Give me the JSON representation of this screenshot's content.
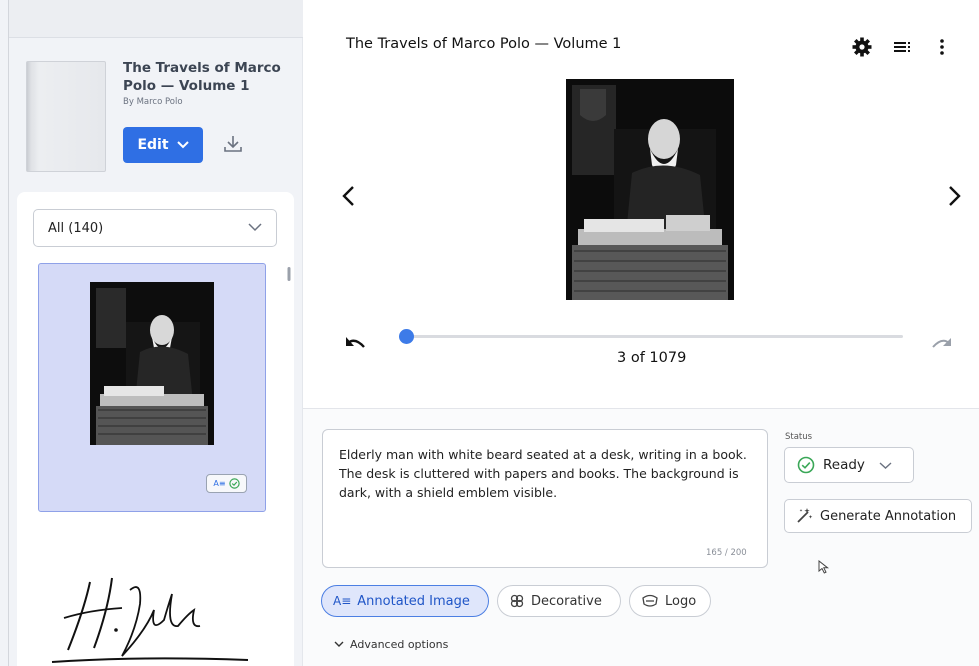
{
  "sidebar": {
    "book": {
      "title": "The Travels of Marco Polo — Volume 1",
      "author": "By Marco Polo",
      "edit_label": "Edit"
    },
    "filter": {
      "selected": "All (140)"
    }
  },
  "viewer": {
    "title": "The Travels of Marco Polo — Volume 1",
    "page_counter": "3 of 1079",
    "progress": {
      "current": 3,
      "total": 1079
    }
  },
  "annotation": {
    "text": "Elderly man with white beard seated at a desk, writing in a book. The desk is cluttered with papers and books. The background is dark, with a shield emblem visible.",
    "char_count": "165 / 200",
    "status_label": "Status",
    "status_value": "Ready",
    "generate_label": "Generate Annotation",
    "types": [
      "Annotated Image",
      "Decorative",
      "Logo"
    ],
    "selected_type": "Annotated Image",
    "advanced_label": "Advanced options"
  },
  "colors": {
    "accent": "#2f6fe4",
    "selected_card": "#d5daf7",
    "status_ok": "#3aa757"
  },
  "icons": {
    "settings": "gear-icon",
    "list": "list-icon",
    "more": "more-vert-icon",
    "prev": "chevron-left-icon",
    "next": "chevron-right-icon",
    "undo": "undo-icon",
    "redo": "redo-icon",
    "download": "download-icon",
    "generate": "magic-wand-icon"
  }
}
